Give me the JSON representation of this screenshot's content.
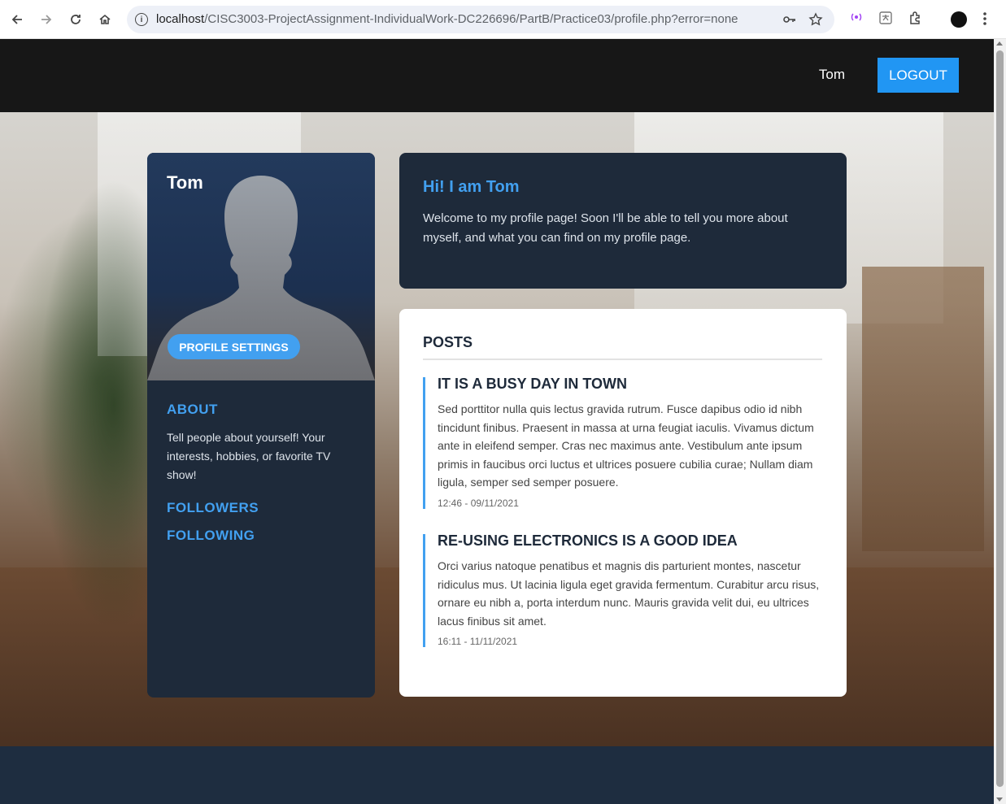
{
  "browser": {
    "url_host": "localhost",
    "url_path": "/CISC3003-ProjectAssignment-IndividualWork-DC226696/PartB/Practice03/profile.php?error=none"
  },
  "navbar": {
    "username": "Tom",
    "logout_label": "LOGOUT"
  },
  "profile": {
    "name": "Tom",
    "settings_label": "PROFILE SETTINGS",
    "about_heading": "ABOUT",
    "about_text": "Tell people about yourself! Your interests, hobbies, or favorite TV show!",
    "followers_label": "FOLLOWERS",
    "following_label": "FOLLOWING"
  },
  "welcome": {
    "title": "Hi! I am Tom",
    "text": "Welcome to my profile page! Soon I'll be able to tell you more about myself, and what you can find on my profile page."
  },
  "posts": {
    "heading": "POSTS",
    "items": [
      {
        "title": "IT IS A BUSY DAY IN TOWN",
        "body": "Sed porttitor nulla quis lectus gravida rutrum. Fusce dapibus odio id nibh tincidunt finibus. Praesent in massa at urna feugiat iaculis. Vivamus dictum ante in eleifend semper. Cras nec maximus ante. Vestibulum ante ipsum primis in faucibus orci luctus et ultrices posuere cubilia curae; Nullam diam ligula, semper sed semper posuere.",
        "date": "12:46 - 09/11/2021"
      },
      {
        "title": "RE-USING ELECTRONICS IS A GOOD IDEA",
        "body": "Orci varius natoque penatibus et magnis dis parturient montes, nascetur ridiculus mus. Ut lacinia ligula eget gravida fermentum. Curabitur arcu risus, ornare eu nibh a, porta interdum nunc. Mauris gravida velit dui, eu ultrices lacus finibus sit amet.",
        "date": "16:11 - 11/11/2021"
      }
    ]
  },
  "colors": {
    "accent": "#2196f3",
    "card_dark": "#1e2a3a",
    "link_blue": "#42a0f0",
    "topbar": "#171717",
    "footer": "#1e2d40"
  }
}
